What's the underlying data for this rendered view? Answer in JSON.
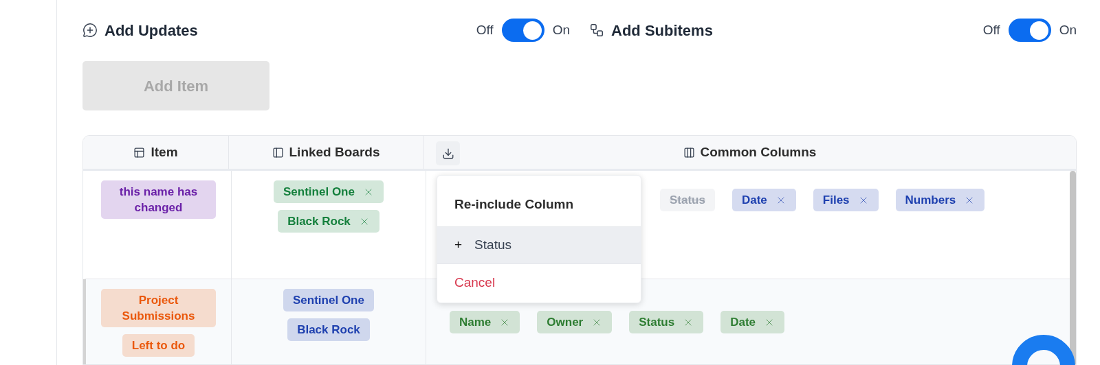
{
  "settings": [
    {
      "kind": "updates",
      "label": "Add Updates",
      "off_label": "Off",
      "on_label": "On",
      "on": true
    },
    {
      "kind": "subitems",
      "label": "Add Subitems",
      "off_label": "Off",
      "on_label": "On",
      "on": true
    }
  ],
  "add_button": {
    "label": "Add Item",
    "disabled": true
  },
  "table": {
    "columns": [
      {
        "kind": "item",
        "label": "Item"
      },
      {
        "kind": "boards",
        "label": "Linked Boards"
      },
      {
        "kind": "columns",
        "label": "Common Columns"
      }
    ],
    "rows": [
      {
        "highlighted": false,
        "items": [
          {
            "label": "this name has changed",
            "color": "#6b21a8"
          }
        ],
        "boards": [
          {
            "label": "Sentinel One",
            "color": "#15803d",
            "removable": true
          },
          {
            "label": "Black Rock",
            "color": "#15803d",
            "removable": true
          }
        ],
        "columns": [
          {
            "label": "Status",
            "color": "#9ca3af",
            "excluded": true,
            "removable": false
          },
          {
            "label": "Date",
            "color": "#1e40af",
            "excluded": false,
            "removable": true
          },
          {
            "label": "Files",
            "color": "#1e40af",
            "excluded": false,
            "removable": true
          },
          {
            "label": "Numbers",
            "color": "#1e40af",
            "excluded": false,
            "removable": true
          }
        ]
      },
      {
        "highlighted": true,
        "items": [
          {
            "label": "Project Submissions",
            "color": "#ea580c"
          },
          {
            "label": "Left to do",
            "color": "#ea580c"
          }
        ],
        "boards": [
          {
            "label": "Sentinel One",
            "color": "#1e40af",
            "removable": false
          },
          {
            "label": "Black Rock",
            "color": "#1e40af",
            "removable": false
          }
        ],
        "columns": [
          {
            "label": "Name",
            "color": "#2e7d32",
            "excluded": false,
            "removable": true
          },
          {
            "label": "Owner",
            "color": "#2e7d32",
            "excluded": false,
            "removable": true
          },
          {
            "label": "Status",
            "color": "#2e7d32",
            "excluded": false,
            "removable": true
          },
          {
            "label": "Date",
            "color": "#2e7d32",
            "excluded": false,
            "removable": true
          }
        ]
      }
    ]
  },
  "menu": {
    "title": "Re-include Column",
    "options": [
      {
        "icon": "+",
        "label": "Status",
        "highlighted": true
      }
    ],
    "cancel": "Cancel"
  }
}
